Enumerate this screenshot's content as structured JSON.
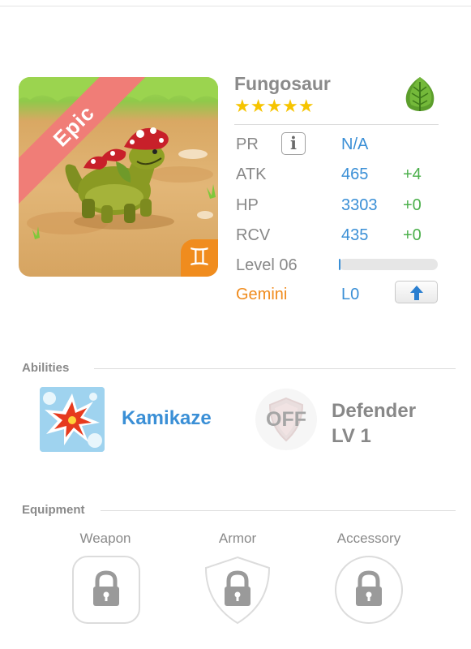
{
  "monster": {
    "name": "Fungosaur",
    "rarity": "Epic",
    "stars": "★★★★★",
    "sign_symbol": "♊",
    "element_icon": "leaf-icon"
  },
  "stats": {
    "pr": {
      "label": "PR",
      "value": "N/A",
      "info_glyph": "i"
    },
    "atk": {
      "label": "ATK",
      "value": "465",
      "bonus": "+4"
    },
    "hp": {
      "label": "HP",
      "value": "3303",
      "bonus": "+0"
    },
    "rcv": {
      "label": "RCV",
      "value": "435",
      "bonus": "+0"
    },
    "level": {
      "label": "Level 06",
      "xp_fraction": 0.02
    },
    "sign": {
      "label": "Gemini",
      "value": "L0"
    }
  },
  "abilities": {
    "title": "Abilities",
    "items": [
      {
        "name": "Kamikaze",
        "icon": "explosion-icon"
      },
      {
        "name_line1": "Defender",
        "name_line2": "LV 1",
        "status": "OFF",
        "icon": "shield-icon"
      }
    ]
  },
  "equipment": {
    "title": "Equipment",
    "slots": [
      {
        "label": "Weapon",
        "icon": "lock-icon"
      },
      {
        "label": "Armor",
        "icon": "lock-icon"
      },
      {
        "label": "Accessory",
        "icon": "lock-icon"
      }
    ]
  },
  "colors": {
    "accent_blue": "#3a8fd6",
    "bonus_green": "#4cb04c",
    "gemini_orange": "#f08c1e",
    "epic_ribbon": "#f07d77",
    "star_gold": "#f6c400"
  }
}
